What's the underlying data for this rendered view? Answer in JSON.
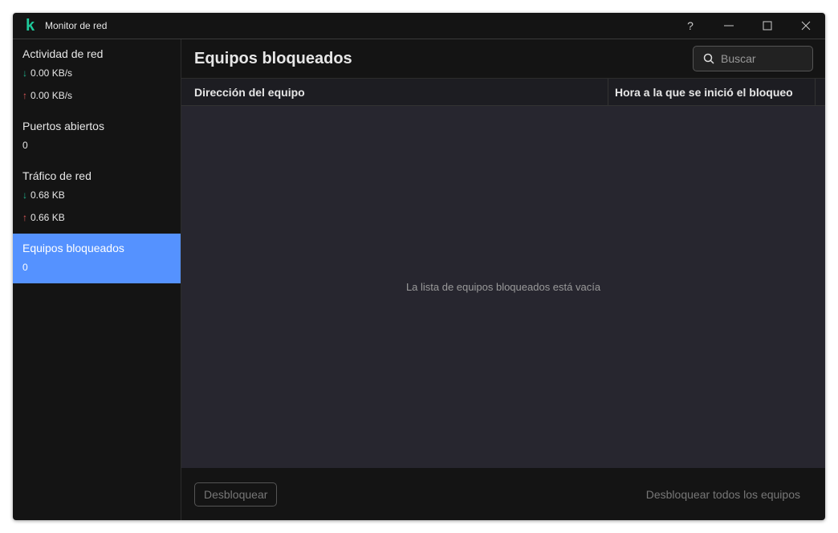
{
  "window": {
    "title": "Monitor de red",
    "logo": "k",
    "help": "?"
  },
  "sidebar": {
    "activity": {
      "title": "Actividad de red",
      "down": "0.00 KB/s",
      "up": "0.00 KB/s"
    },
    "ports": {
      "title": "Puertos abiertos",
      "value": "0"
    },
    "traffic": {
      "title": "Tráfico de red",
      "down": "0.68 KB",
      "up": "0.66 KB"
    },
    "blocked": {
      "title": "Equipos bloqueados",
      "value": "0"
    }
  },
  "main": {
    "title": "Equipos bloqueados",
    "search_placeholder": "Buscar",
    "columns": [
      "Dirección del equipo",
      "Hora a la que se inició el bloqueo"
    ],
    "empty": "La lista de equipos bloqueados está vacía",
    "unblock": "Desbloquear",
    "unblock_all": "Desbloquear todos los equipos"
  },
  "colors": {
    "accent": "#5592ff",
    "brand": "#1fc99b"
  }
}
